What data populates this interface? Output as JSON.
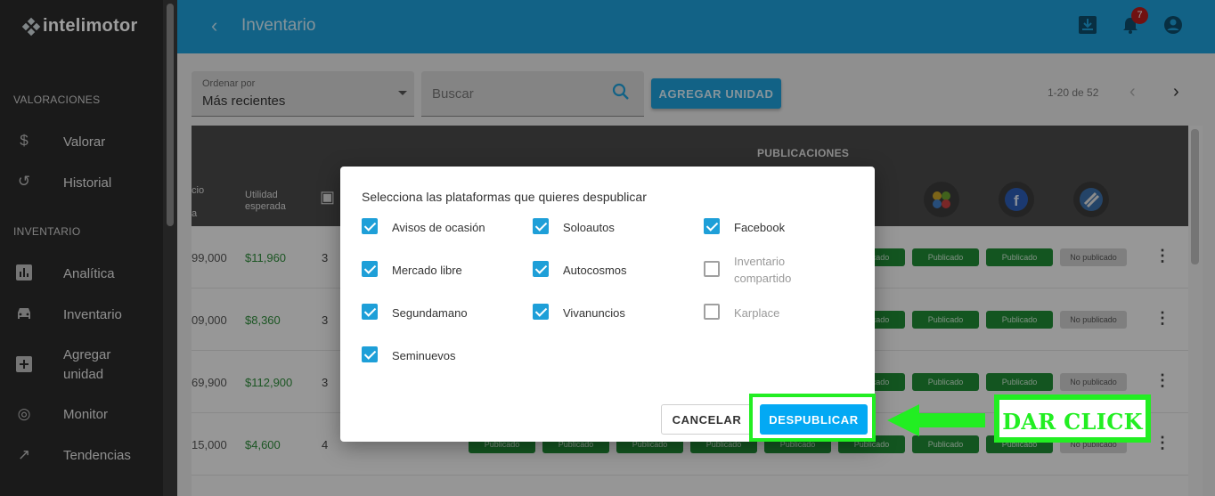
{
  "app": {
    "brand": "intelimotor"
  },
  "sidebar": {
    "sections": [
      {
        "title": "VALORACIONES"
      },
      {
        "title": "INVENTARIO"
      }
    ],
    "items": [
      {
        "label": "Valorar",
        "icon": "dollar-icon"
      },
      {
        "label": "Historial",
        "icon": "history-icon"
      },
      {
        "label": "Analítica",
        "icon": "bar-chart-icon"
      },
      {
        "label": "Inventario",
        "icon": "car-icon"
      },
      {
        "label": "Agregar unidad",
        "icon": "add-box-icon"
      },
      {
        "label": "Monitor",
        "icon": "monitor-icon"
      },
      {
        "label": "Tendencias",
        "icon": "trending-up-icon"
      }
    ]
  },
  "header": {
    "title": "Inventario",
    "notifications_count": "7",
    "icons": [
      "download-box-icon",
      "bell-icon",
      "account-icon"
    ],
    "bg_color": "#1e9fd8"
  },
  "toolbar": {
    "sort_label": "Ordenar por",
    "sort_value": "Más recientes",
    "search_placeholder": "Buscar",
    "add_label": "AGREGAR UNIDAD",
    "pagination": "1-20 de 52"
  },
  "table": {
    "pub_title": "PUBLICACIONES",
    "col_price": "cio",
    "col_price_2": "a",
    "col_util": "Utilidad esperada",
    "rows": [
      {
        "price": "99,000",
        "util": "$11,960",
        "count": "3"
      },
      {
        "price": "09,000",
        "util": "$8,360",
        "count": "3"
      },
      {
        "price": "69,900",
        "util": "$112,900",
        "count": "3"
      },
      {
        "price": "15,000",
        "util": "$4,600",
        "count": "4"
      }
    ],
    "chip_published": "Publicado",
    "chip_unpublished": "No publicado"
  },
  "dialog": {
    "title": "Selecciona las plataformas que quieres despublicar",
    "options": [
      {
        "label": "Avisos de ocasión",
        "checked": true
      },
      {
        "label": "Soloautos",
        "checked": true
      },
      {
        "label": "Facebook",
        "checked": true
      },
      {
        "label": "Mercado libre",
        "checked": true
      },
      {
        "label": "Autocosmos",
        "checked": true
      },
      {
        "label": "Inventario compartido",
        "checked": false
      },
      {
        "label": "Segundamano",
        "checked": true
      },
      {
        "label": "Vivanuncios",
        "checked": true
      },
      {
        "label": "Karplace",
        "checked": false
      },
      {
        "label": "Seminuevos",
        "checked": true
      }
    ],
    "cancel_label": "CANCELAR",
    "confirm_label": "DESPUBLICAR",
    "accent_color": "#03a9f4"
  },
  "annotation": {
    "text": "DAR CLICK",
    "color": "#22ee22"
  }
}
